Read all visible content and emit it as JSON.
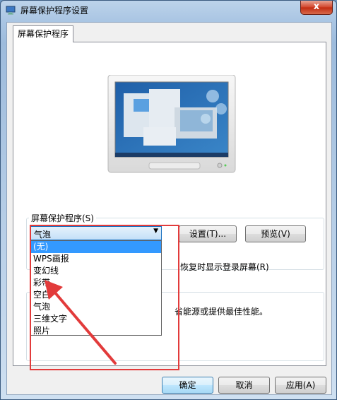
{
  "window": {
    "title": "屏幕保护程序设置",
    "close_label": "x"
  },
  "tab": {
    "label": "屏幕保护程序"
  },
  "screensaver": {
    "group_label": "屏幕保护程序(S)",
    "selected": "气泡",
    "settings_button": "设置(T)...",
    "preview_button": "预览(V)",
    "options": [
      "(无)",
      "WPS画报",
      "变幻线",
      "彩带",
      "空白",
      "气泡",
      "三维文字",
      "照片"
    ],
    "highlighted_option": "(无)",
    "resume_text": "恢复时显示登录屏幕(R)"
  },
  "power": {
    "text_fragment": "省能源或提供最佳性能。"
  },
  "footer": {
    "ok": "确定",
    "cancel": "取消",
    "apply": "应用(A)"
  },
  "colors": {
    "highlight_box": "#e23b3b",
    "selection": "#3399ff"
  }
}
